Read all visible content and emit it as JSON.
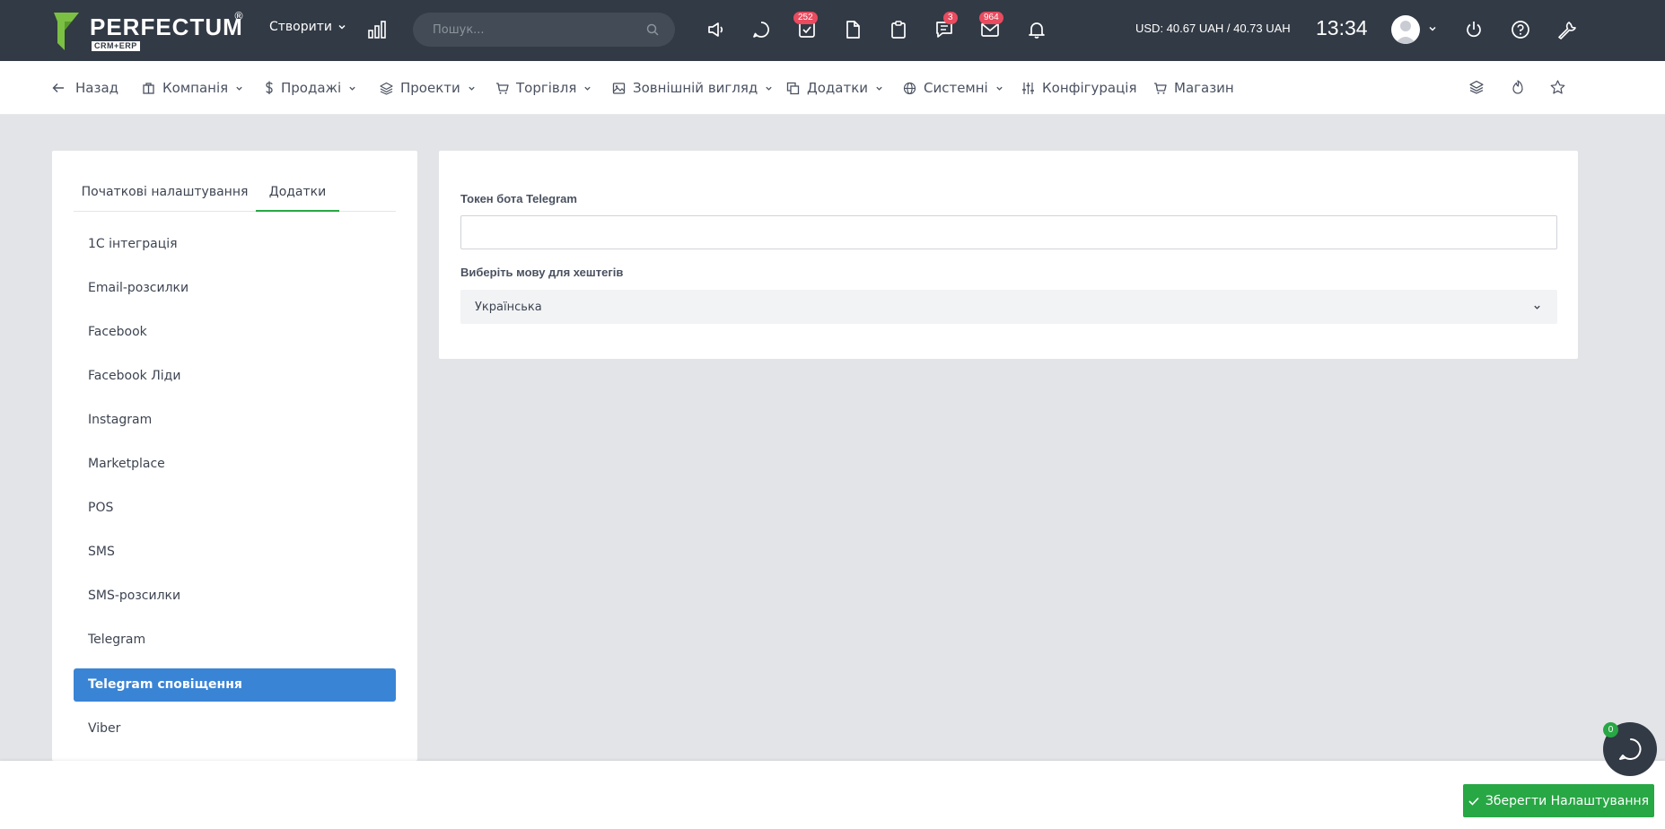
{
  "brand": {
    "name": "PERFECTUM",
    "sub": "CRM+ERP",
    "reg": "®"
  },
  "topbar": {
    "create_label": "Створити",
    "search_placeholder": "Пошук...",
    "badges": {
      "tasks": "252",
      "messages": "3",
      "mail": "964"
    },
    "currency": "USD: 40.67 UAH / 40.73 UAH",
    "time": "13:34"
  },
  "nav": {
    "back": "Назад",
    "items": [
      "Компанія",
      "Продажі",
      "Проекти",
      "Торгівля",
      "Зовнішній вигляд",
      "Додатки",
      "Системні",
      "Конфігурація",
      "Магазин"
    ]
  },
  "tabs": [
    "Початкові налаштування",
    "Додатки"
  ],
  "active_tab": "Додатки",
  "sidebar_items": [
    "1С інтеграція",
    "Email-розсилки",
    "Facebook",
    "Facebook Ліди",
    "Instagram",
    "Marketplace",
    "POS",
    "SMS",
    "SMS-розсилки",
    "Telegram",
    "Telegram сповіщення",
    "Viber"
  ],
  "active_sidebar_item": "Telegram сповіщення",
  "form": {
    "token_label": "Токен бота Telegram",
    "token_value": "",
    "lang_label": "Виберіть мову для хештегів",
    "lang_value": "Українська"
  },
  "save_label": "Зберегти Налаштування",
  "chat_badge": "0",
  "colors": {
    "topbar": "#323a45",
    "accent_green": "#28a745",
    "active_blue": "#3a84d5",
    "badge_red": "#e94b5f"
  }
}
